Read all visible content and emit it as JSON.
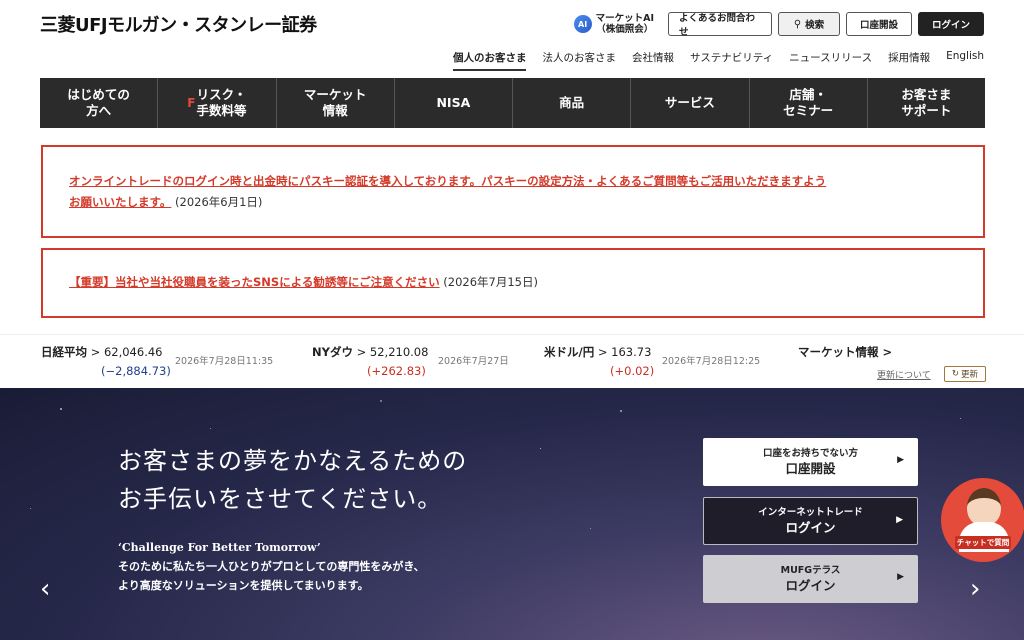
{
  "header": {
    "logo": "三菱UFJモルガン・スタンレー証券",
    "ai": {
      "badge": "AI",
      "line1": "マーケットAI",
      "line2": "（株価照会）"
    },
    "util_buttons": {
      "faq": "よくあるお問合わせ",
      "search": "検索",
      "account_open": "口座開設",
      "login": "ログイン"
    },
    "subnav": [
      "個人のお客さま",
      "法人のお客さま",
      "会社情報",
      "サステナビリティ",
      "ニュースリリース",
      "採用情報",
      "English"
    ]
  },
  "mainnav": [
    {
      "label": "はじめての\n方へ"
    },
    {
      "label": "リスク・\n手数料等",
      "icon": "F"
    },
    {
      "label": "マーケット\n情報"
    },
    {
      "label": "NISA"
    },
    {
      "label": "商品"
    },
    {
      "label": "サービス"
    },
    {
      "label": "店舗・\nセミナー"
    },
    {
      "label": "お客さま\nサポート"
    }
  ],
  "notices": [
    {
      "link_line1": "オンライントレードのログイン時と出金時にパスキー認証を導入しております。パスキーの設定方法・よくあるご質問等もご活用いただきますよう",
      "link_line2": "お願いいたします。",
      "date": "(2026年6月1日)"
    },
    {
      "link": "【重要】当社や当社役職員を装ったSNSによる勧誘等にご注意ください",
      "date": "(2026年7月15日)"
    }
  ],
  "ticker": {
    "items": [
      {
        "name": "日経平均",
        "value": "62,046.46",
        "change": "(−2,884.73)",
        "time": "2026年7月28日11:35"
      },
      {
        "name": "NYダウ",
        "value": "52,210.08",
        "change": "(+262.83)",
        "time": "2026年7月27日"
      },
      {
        "name": "米ドル/円",
        "value": "163.73",
        "change": "(+0.02)",
        "time": "2026年7月28日12:25"
      }
    ],
    "market_link": "マーケット情報",
    "about_update": "更新について",
    "update_button": "更新"
  },
  "hero": {
    "title": "お客さまの夢をかなえるための\nお手伝いをさせてください。",
    "sub": "‘Challenge For Better Tomorrow’\nそのために私たち一人ひとりがプロとしての専門性をみがき、\nより高度なソリューションを提供してまいります。",
    "cta": [
      {
        "small": "口座をお持ちでない方",
        "big": "口座開設"
      },
      {
        "small": "インターネットトレード",
        "big": "ログイン"
      },
      {
        "small": "MUFGテラス",
        "big": "ログイン"
      }
    ],
    "chat_label": "チャットで質問"
  },
  "colors": {
    "accent_red": "#d43a2a",
    "nav_dark": "#2b2b2b",
    "negative": "#233f8c",
    "positive": "#c8301f"
  }
}
